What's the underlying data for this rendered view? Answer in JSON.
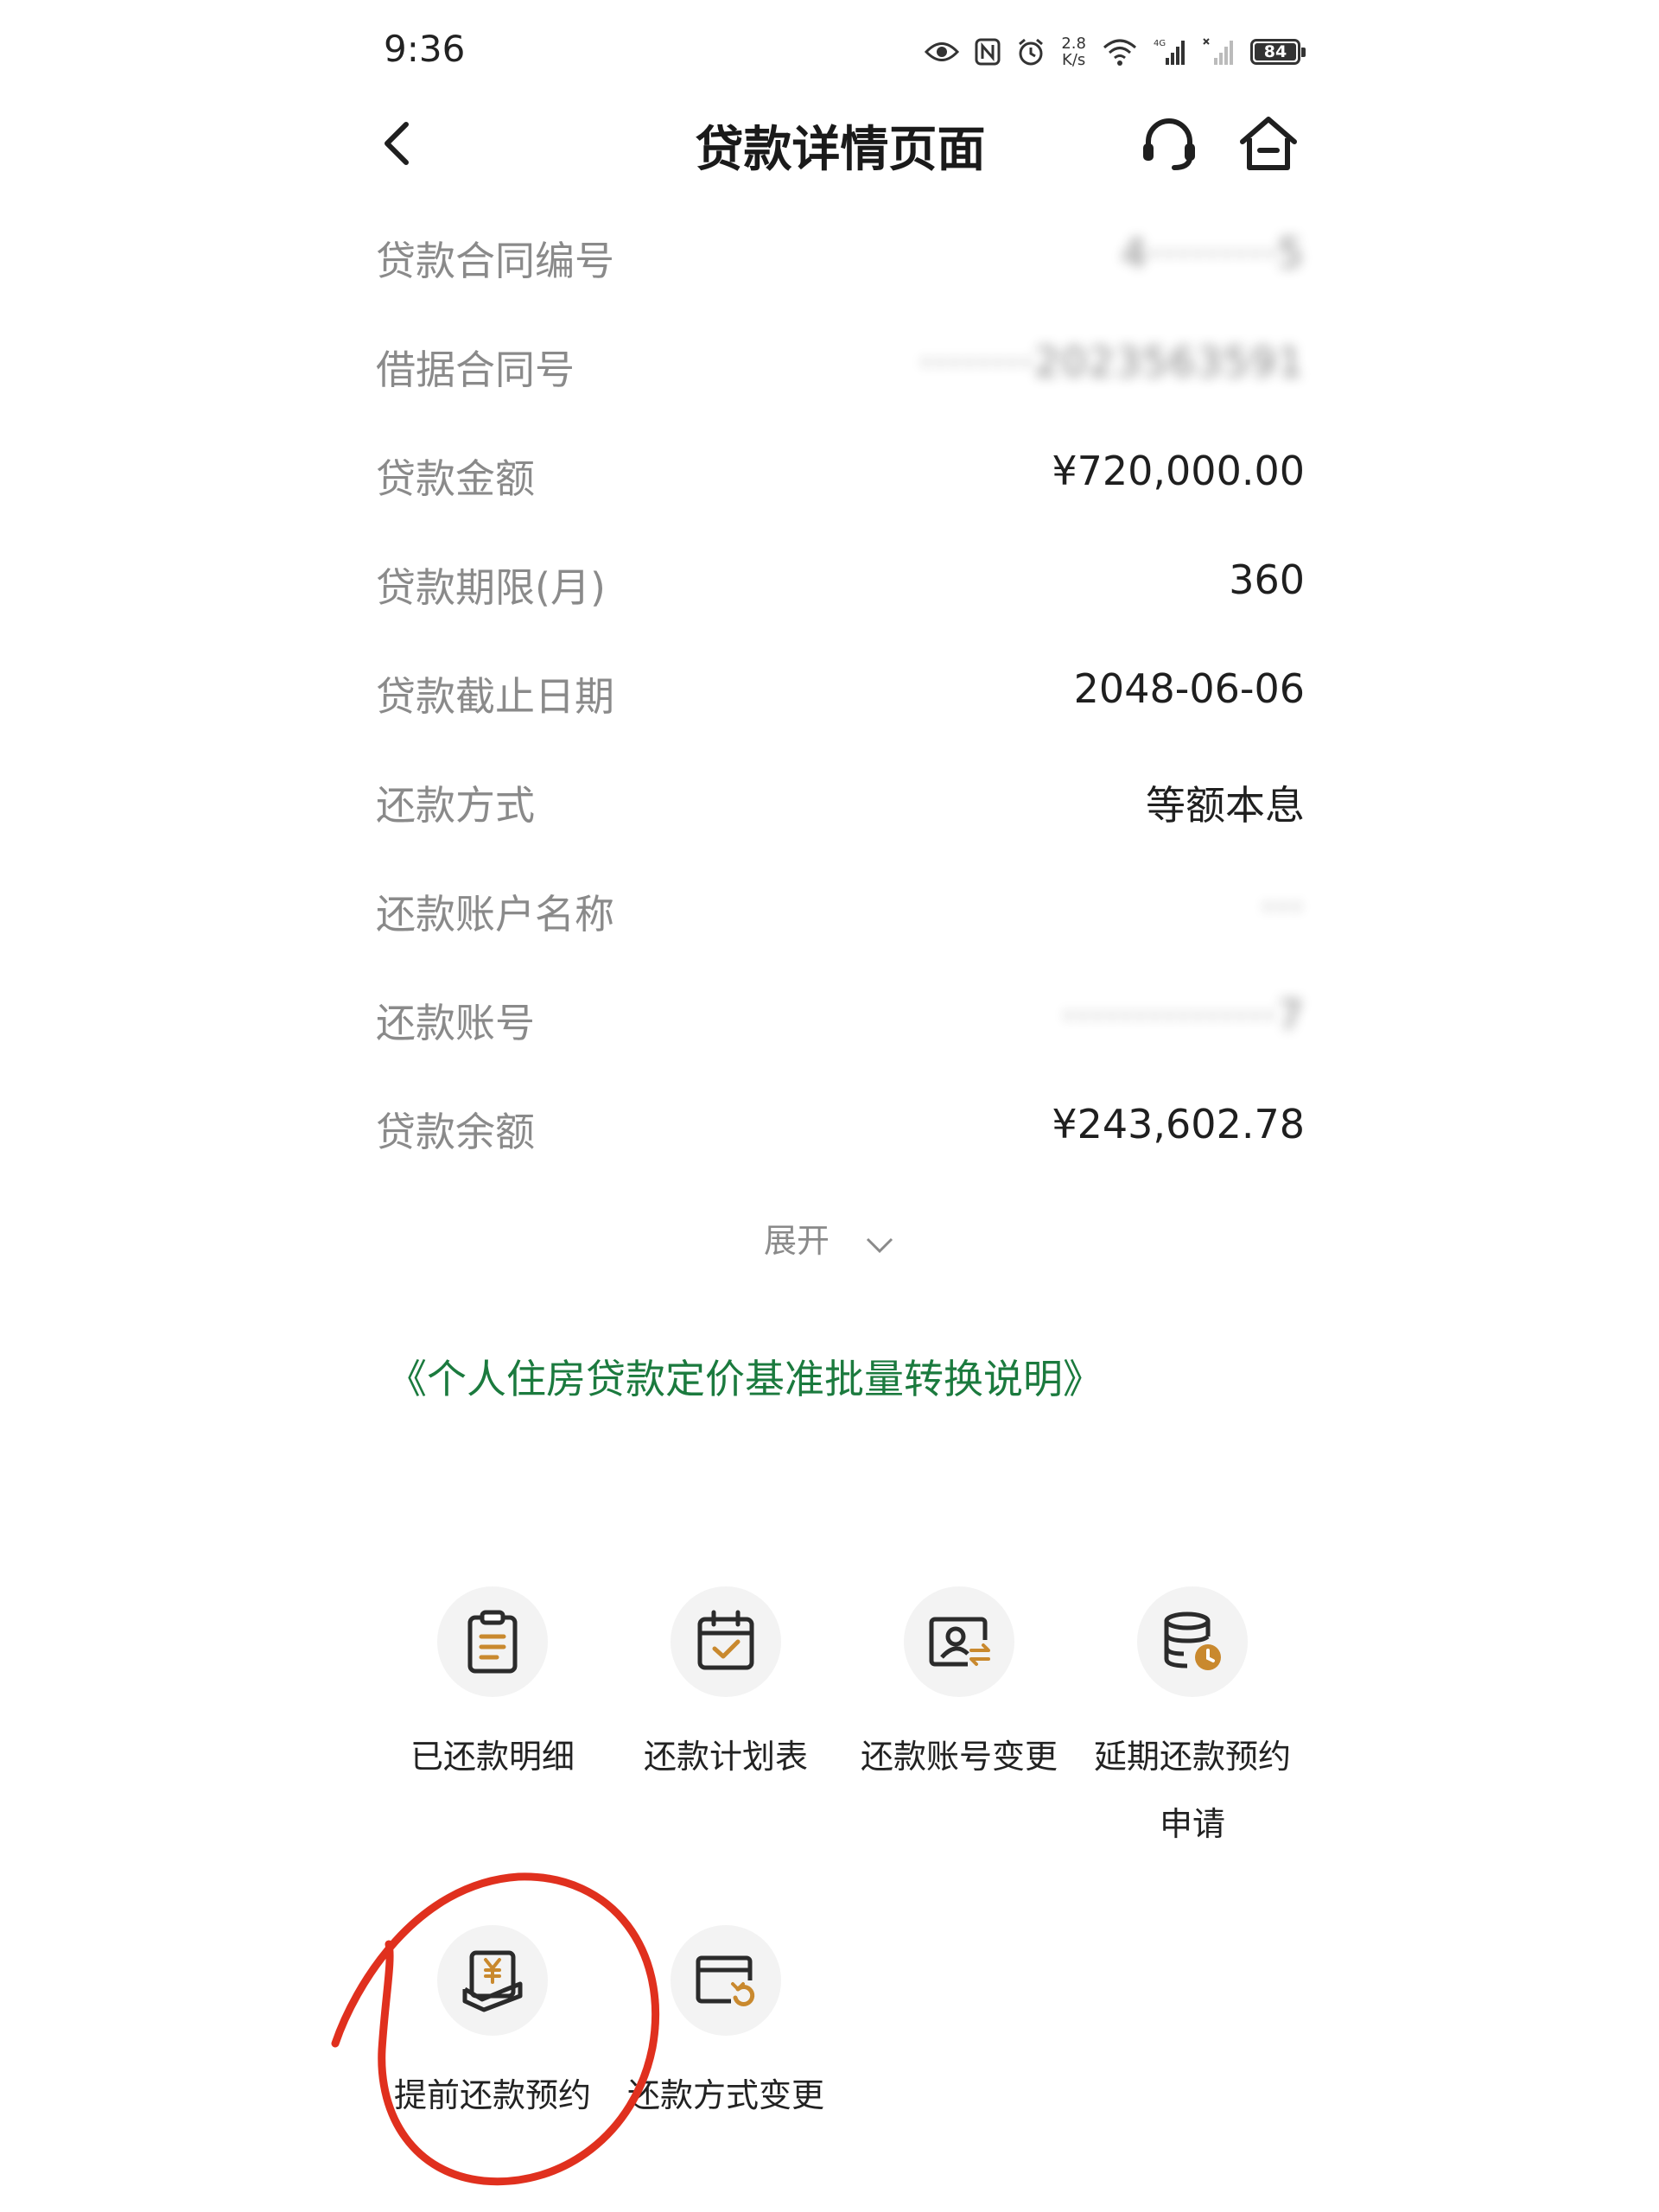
{
  "status_bar": {
    "time": "9:36",
    "net_speed_value": "2.8",
    "net_speed_unit": "K/s",
    "battery": "84"
  },
  "header": {
    "title": "贷款详情页面"
  },
  "details": [
    {
      "label": "贷款合同编号",
      "value": "4·········5",
      "masked": true
    },
    {
      "label": "借据合同号",
      "value": "········2023563591",
      "masked": true
    },
    {
      "label": "贷款金额",
      "value": "¥720,000.00"
    },
    {
      "label": "贷款期限(月)",
      "value": "360"
    },
    {
      "label": "贷款截止日期",
      "value": "2048-06-06"
    },
    {
      "label": "还款方式",
      "value": "等额本息"
    },
    {
      "label": "还款账户名称",
      "value": "···",
      "masked": true
    },
    {
      "label": "还款账号",
      "value": "···············7",
      "masked": true
    },
    {
      "label": "贷款余额",
      "value": "¥243,602.78"
    }
  ],
  "expand_label": "展开",
  "doc_link": "《个人住房贷款定价基准批量转换说明》",
  "functions": {
    "repaid_details": "已还款明细",
    "repayment_schedule": "还款计划表",
    "account_change": "还款账号变更",
    "deferral_line1": "延期还款预约",
    "deferral_line2": "申请",
    "prepayment": "提前还款预约",
    "method_change": "还款方式变更"
  },
  "colors": {
    "link_green": "#1b7a3e",
    "icon_gold": "#c9892e",
    "icon_dark": "#2b2b2b",
    "annotation_red": "#e0301e"
  },
  "icons": {
    "back": "chevron-left-icon",
    "service": "headset-icon",
    "home": "home-icon"
  }
}
